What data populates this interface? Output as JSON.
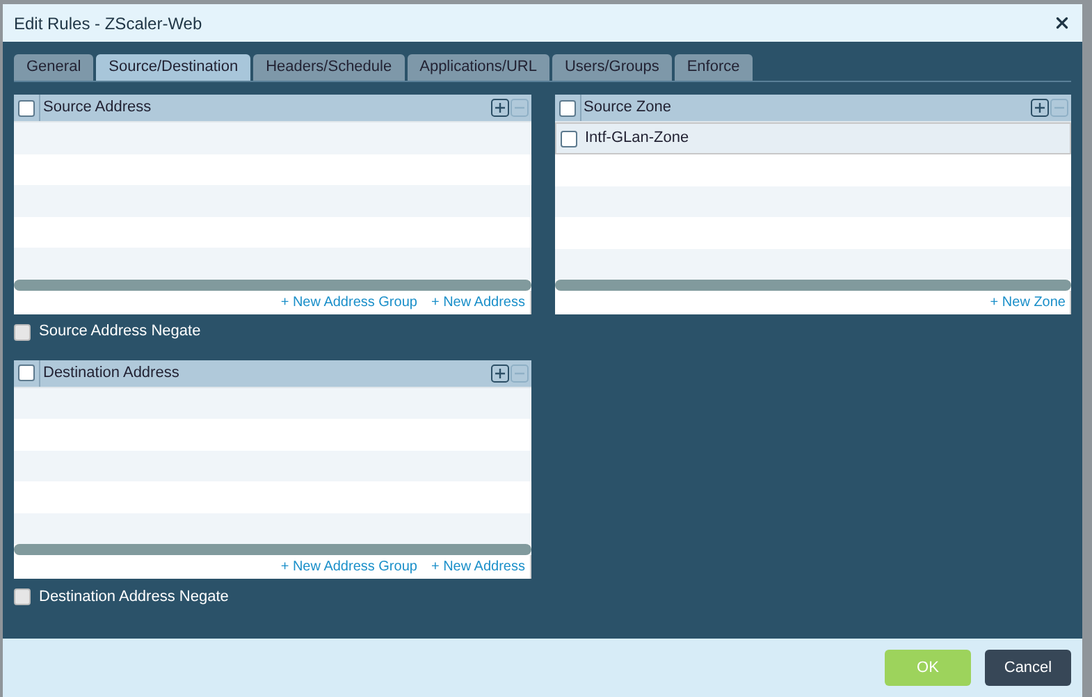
{
  "dialog": {
    "title": "Edit Rules - ZScaler-Web"
  },
  "tabs": [
    {
      "label": "General",
      "selected": false
    },
    {
      "label": "Source/Destination",
      "selected": true
    },
    {
      "label": "Headers/Schedule",
      "selected": false
    },
    {
      "label": "Applications/URL",
      "selected": false
    },
    {
      "label": "Users/Groups",
      "selected": false
    },
    {
      "label": "Enforce",
      "selected": false
    }
  ],
  "source_address": {
    "title": "Source Address",
    "checked": false,
    "links": [
      "+ New Address Group",
      "+ New Address"
    ]
  },
  "source_address_negate": {
    "label": "Source Address Negate",
    "checked": false
  },
  "destination_address": {
    "title": "Destination Address",
    "checked": false,
    "links": [
      "+ New Address Group",
      "+ New Address"
    ]
  },
  "destination_address_negate": {
    "label": "Destination Address Negate",
    "checked": false
  },
  "source_zone": {
    "title": "Source Zone",
    "checked": false,
    "rows": [
      {
        "label": "Intf-GLan-Zone",
        "checked": false
      }
    ],
    "links": [
      "+ New Zone"
    ]
  },
  "buttons": [
    {
      "label": "OK",
      "kind": "primary"
    },
    {
      "label": "Cancel",
      "kind": "secondary"
    }
  ]
}
